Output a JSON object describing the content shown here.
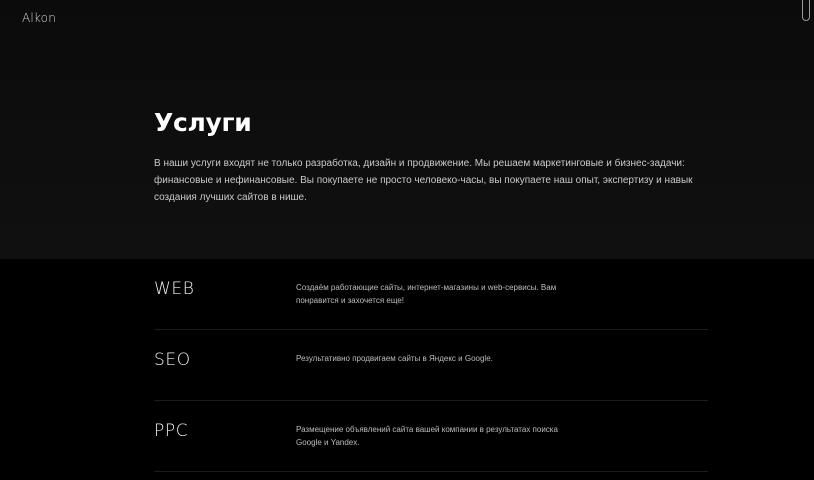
{
  "header": {
    "logo": "Alkon"
  },
  "hero": {
    "title": "Услуги",
    "intro": "В наши услуги входят не только разработка, дизайн и продвижение. Мы решаем маркетинговые и бизнес-задачи: финансовые и нефинансовые. Вы покупаете не просто человеко-часы, вы покупаете наш опыт, экспертизу и навык создания лучших сайтов в нише."
  },
  "services": [
    {
      "name": "WEB",
      "desc": "Создаём работающие сайты, интернет-магазины и web-сервисы. Вам понравится и захочется еще!"
    },
    {
      "name": "SEO",
      "desc": "Результативно продвигаем сайты в Яндекс и Google."
    },
    {
      "name": "PPC",
      "desc": "Размещение объявлений сайта вашей компании в результатах поиска Google и Yandex."
    }
  ]
}
